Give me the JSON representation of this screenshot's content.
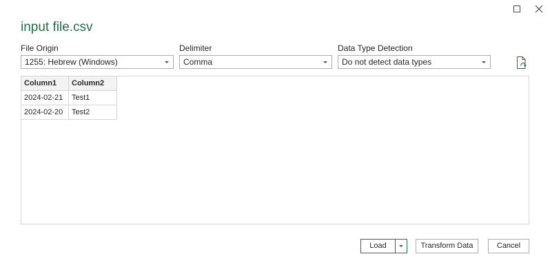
{
  "dialog": {
    "title": "input file.csv"
  },
  "window_controls": {
    "maximize_icon": "maximize-icon",
    "close_icon": "close-icon"
  },
  "file_origin": {
    "label": "File Origin",
    "value": "1255: Hebrew (Windows)"
  },
  "delimiter": {
    "label": "Delimiter",
    "value": "Comma"
  },
  "data_type_detection": {
    "label": "Data Type Detection",
    "value": "Do not detect data types"
  },
  "refresh": {
    "icon": "refresh-file-icon"
  },
  "preview": {
    "columns": [
      "Column1",
      "Column2"
    ],
    "rows": [
      [
        "2024-02-21",
        "Test1"
      ],
      [
        "2024-02-20",
        "Test2"
      ]
    ]
  },
  "buttons": {
    "load": "Load",
    "transform": "Transform Data",
    "cancel": "Cancel"
  },
  "colors": {
    "accent": "#217346",
    "border": "#ababab"
  }
}
